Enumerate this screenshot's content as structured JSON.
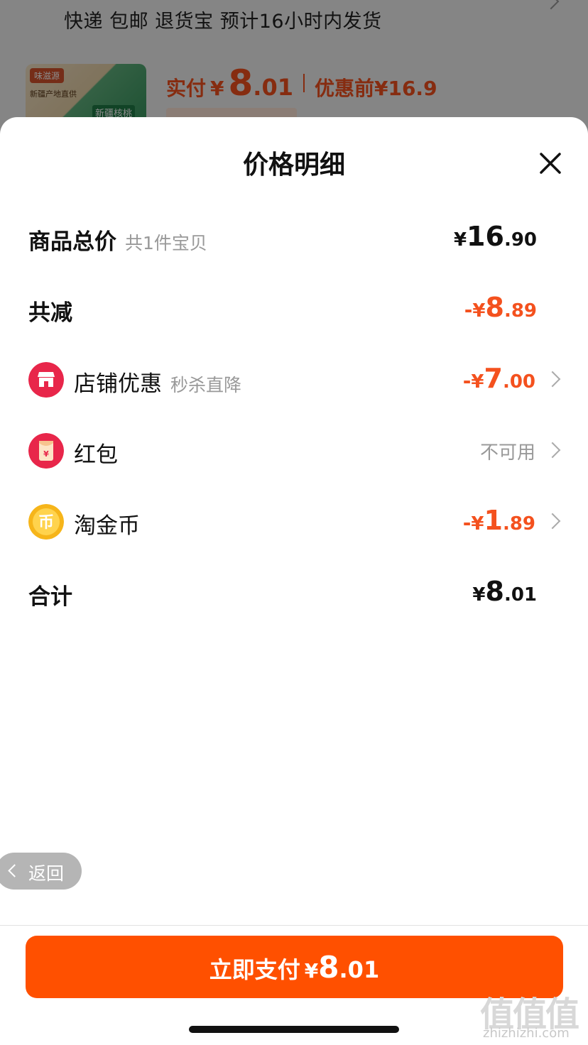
{
  "background": {
    "shipping_line": "快递 包邮 退货宝 预计16小时内发货",
    "product_thumb": {
      "brand": "味滋源",
      "line1": "新疆产地直供",
      "line2": "新疆核桃"
    },
    "price": {
      "label": "实付",
      "yen": "¥",
      "integer": "8",
      "decimal": ".01",
      "before_label": "优惠前¥16.9"
    }
  },
  "sheet": {
    "title": "价格明细",
    "rows": [
      {
        "label": "商品总价",
        "sub": "共1件宝贝",
        "value": {
          "sign": "",
          "yen": "¥",
          "integer": "16",
          "decimal": ".90"
        },
        "color": "#111111"
      },
      {
        "label": "共减",
        "sub": "",
        "value": {
          "sign": "-",
          "yen": "¥",
          "integer": "8",
          "decimal": ".89"
        },
        "color": "#f4511e"
      },
      {
        "icon": "store-icon",
        "label": "店铺优惠",
        "sub": "秒杀直降",
        "value": {
          "sign": "-",
          "yen": "¥",
          "integer": "7",
          "decimal": ".00"
        },
        "color": "#f4511e"
      },
      {
        "icon": "red-packet-icon",
        "label": "红包",
        "sub": "",
        "value_text": "不可用"
      },
      {
        "icon": "gold-coin-icon",
        "label": "淘金币",
        "sub": "",
        "value": {
          "sign": "-",
          "yen": "¥",
          "integer": "1",
          "decimal": ".89"
        },
        "color": "#f4511e"
      },
      {
        "label": "合计",
        "sub": "",
        "value": {
          "sign": "",
          "yen": "¥",
          "integer": "8",
          "decimal": ".01"
        },
        "color": "#111111"
      }
    ],
    "back_label": "返回",
    "pay_button": {
      "label": "立即支付",
      "yen": "¥",
      "integer": "8",
      "decimal": ".01"
    }
  },
  "watermark": {
    "logo": "值值值",
    "url": "zhizhizhi.com"
  },
  "colors": {
    "accent": "#ff5000",
    "discount": "#f4511e"
  }
}
